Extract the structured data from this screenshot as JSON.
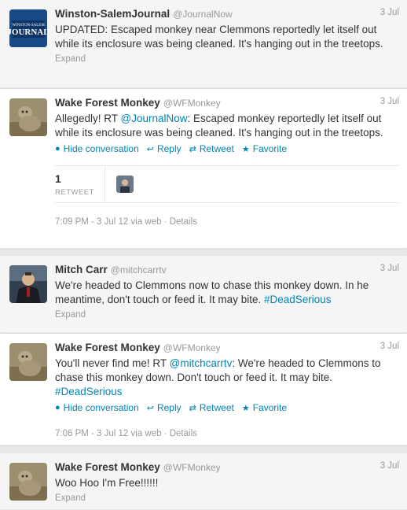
{
  "tweets": [
    {
      "name": "Winston-SalemJournal",
      "handle": "@JournalNow",
      "time": "3 Jul",
      "text": "UPDATED: Escaped monkey near Clemmons reportedly let itself out while its enclosure was being cleaned. It's hanging out in the treetops.",
      "expand": "Expand",
      "avatar_text": "Winston-Salem JOURNAL"
    },
    {
      "name": "Wake Forest Monkey",
      "handle": "@WFMonkey",
      "time": "3 Jul",
      "text_before": "Allegedly! RT ",
      "mention": "@JournalNow",
      "text_after": ": Escaped monkey reportedly let itself out while its enclosure was being cleaned. It's hanging out in the treetops.",
      "actions": {
        "hide": "Hide conversation",
        "reply": "Reply",
        "retweet": "Retweet",
        "favorite": "Favorite"
      },
      "retweet_count": "1",
      "retweet_label": "RETWEET",
      "meta": "7:09 PM - 3 Jul 12 via web · Details"
    },
    {
      "name": "Mitch Carr",
      "handle": "@mitchcarrtv",
      "time": "3 Jul",
      "text_before": "We're headed to Clemmons now to chase this monkey down. In he meantime, don't touch or feed it. It may bite. ",
      "hashtag": "#DeadSerious",
      "expand": "Expand"
    },
    {
      "name": "Wake Forest Monkey",
      "handle": "@WFMonkey",
      "time": "3 Jul",
      "text_before": "You'll never find me! RT ",
      "mention": "@mitchcarrtv",
      "text_after": ": We're headed to Clemmons to chase this monkey down. Don't touch or feed it. It may bite. ",
      "hashtag": "#DeadSerious",
      "actions": {
        "hide": "Hide conversation",
        "reply": "Reply",
        "retweet": "Retweet",
        "favorite": "Favorite"
      },
      "meta": "7:06 PM - 3 Jul 12 via web · Details"
    },
    {
      "name": "Wake Forest Monkey",
      "handle": "@WFMonkey",
      "time": "3 Jul",
      "text": "Woo Hoo I'm Free!!!!!!",
      "expand": "Expand"
    }
  ],
  "colors": {
    "link": "#0084b4",
    "muted": "#999999",
    "name": "#333333"
  },
  "icons": {
    "hide": "conversation-icon",
    "reply": "reply-arrow-icon",
    "retweet": "retweet-icon",
    "favorite": "star-icon"
  }
}
